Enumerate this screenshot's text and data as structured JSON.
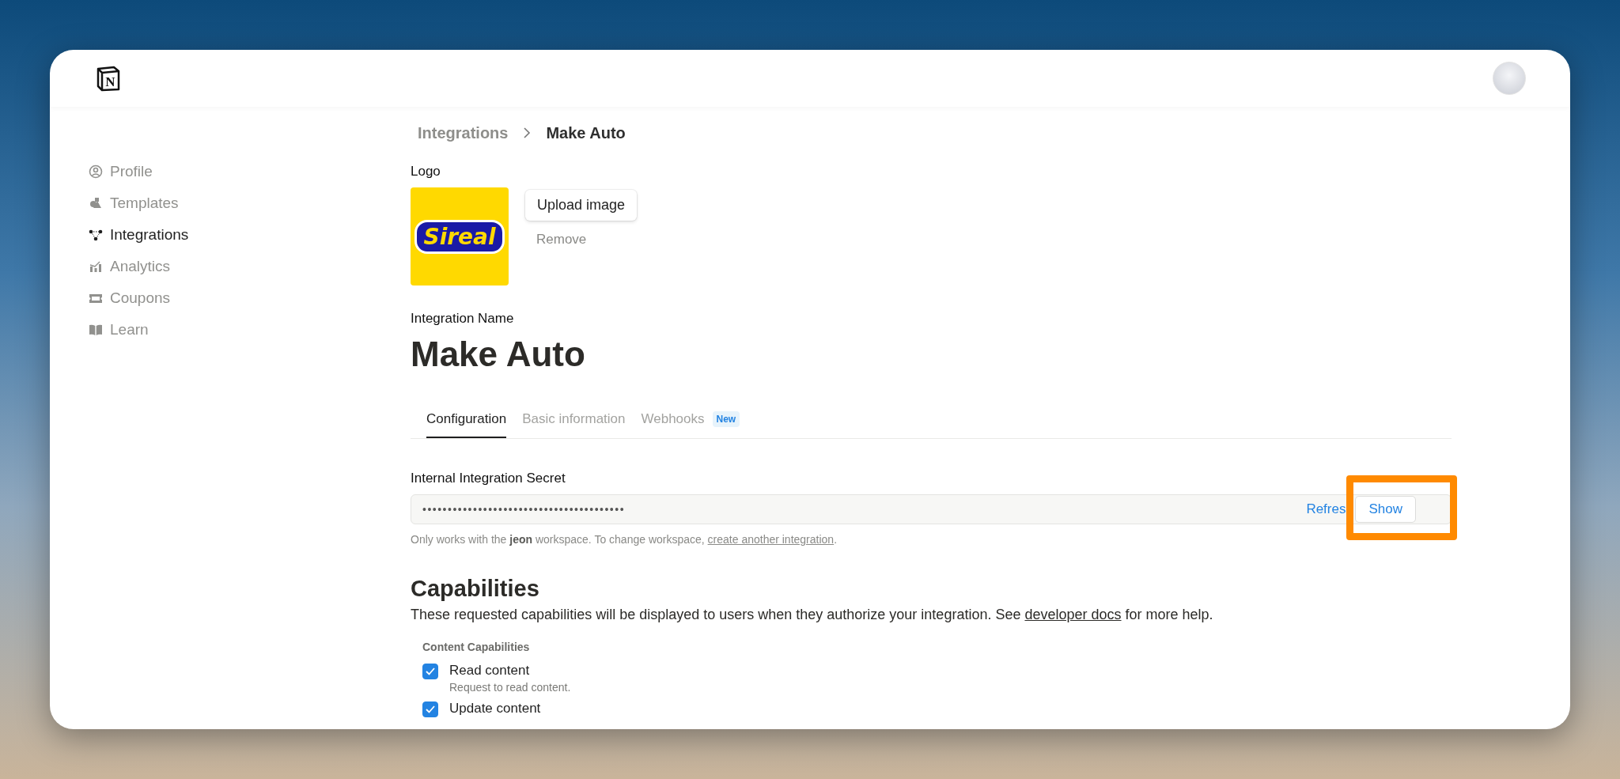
{
  "header": {
    "logo_letter": "N"
  },
  "sidebar": {
    "items": [
      {
        "label": "Profile",
        "selected": false
      },
      {
        "label": "Templates",
        "selected": false
      },
      {
        "label": "Integrations",
        "selected": true
      },
      {
        "label": "Analytics",
        "selected": false
      },
      {
        "label": "Coupons",
        "selected": false
      },
      {
        "label": "Learn",
        "selected": false
      }
    ]
  },
  "breadcrumb": [
    "Integrations",
    "Make Auto"
  ],
  "logo": {
    "label": "Logo",
    "image_text": "Sireal",
    "upload_button": "Upload image",
    "remove_button": "Remove"
  },
  "integration_name": {
    "label": "Integration Name",
    "value": "Make Auto"
  },
  "tabs": [
    {
      "label": "Configuration",
      "selected": true
    },
    {
      "label": "Basic information",
      "selected": false
    },
    {
      "label": "Webhooks",
      "selected": false,
      "badge": "New"
    }
  ],
  "secret": {
    "label": "Internal Integration Secret",
    "value": "••••••••••••••••••••••••••••••••••••••••",
    "refresh_button": "Refres",
    "show_button": "Show",
    "highlighted": true,
    "helper_before": "Only works with the **jeon** workspace. To change workspace, ",
    "helper_link": "create another integration",
    "helper_after": "."
  },
  "capabilities": {
    "title": "Capabilities",
    "description_before": "These requested capabilities will be displayed to users when they authorize your integration. See ",
    "description_link": "developer docs",
    "description_after": " for more help.",
    "group_label": "Content Capabilities",
    "items": [
      {
        "label": "Read content",
        "description": "Request to read content.",
        "checked": true
      },
      {
        "label": "Update content",
        "checked": true
      }
    ]
  }
}
